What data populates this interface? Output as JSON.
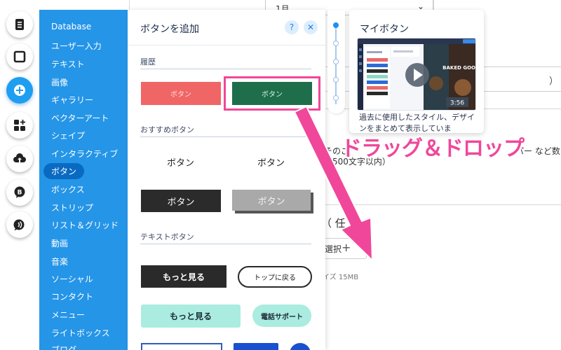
{
  "background": {
    "month_select": "1月",
    "box_text": "）",
    "text_line1": "そのご",
    "text_line1_right": "パー など数",
    "text_line2": "（500文字以内）",
    "text_line3": "（ 任",
    "file_button": "選択",
    "file_size_note": "イズ 15MB"
  },
  "rail": {
    "icons": [
      "pages-icon",
      "background-icon",
      "add-icon",
      "apps-icon",
      "upload-icon",
      "blog-icon",
      "chat-icon"
    ]
  },
  "categories": [
    "Database",
    "ユーザー入力",
    "テキスト",
    "画像",
    "ギャラリー",
    "ベクターアート",
    "シェイプ",
    "インタラクティブ",
    "ボタン",
    "ボックス",
    "ストリップ",
    "リスト＆グリッド",
    "動画",
    "音楽",
    "ソーシャル",
    "コンタクト",
    "メニュー",
    "ライトボックス",
    "ブログ"
  ],
  "active_category": "ボタン",
  "add_panel": {
    "title": "ボタンを追加",
    "help": "?",
    "close": "✕",
    "section_history": "履歴",
    "history_buttons": [
      "ボタン",
      "ボタン"
    ],
    "section_recommended": "おすすめボタン",
    "recommended_buttons": [
      "ボタン",
      "ボタン",
      "ボタン",
      "ボタン"
    ],
    "section_text": "テキストボタン",
    "text_buttons": [
      "もっと見る",
      "トップに戻る",
      "もっと見る",
      "電話サポート"
    ]
  },
  "preview_card": {
    "title": "マイボタン",
    "description": "過去に使用したスタイル、デザインをまとめて表示していま",
    "video_duration": "3:56",
    "video_caption": "BAKED GOODS"
  },
  "annotation": {
    "label": "ドラッグ＆ドロップ"
  },
  "colors": {
    "accent_blue": "#2595e8",
    "active_blue": "#0a6ac2",
    "annotation_pink": "#f0479b",
    "salmon": "#f06565",
    "green": "#1f6e4b",
    "mint": "#aaece0"
  }
}
